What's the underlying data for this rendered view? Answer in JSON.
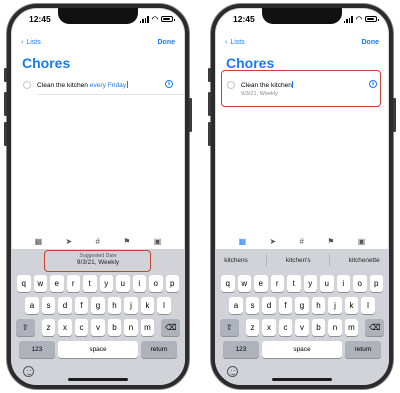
{
  "status": {
    "time": "12:45"
  },
  "nav": {
    "back_label": "Lists",
    "done_label": "Done"
  },
  "list_title": "Chores",
  "left": {
    "item_prefix": "Clean the kitchen ",
    "item_highlight": "every Friday",
    "suggestion_label": "Suggested Date",
    "suggestion_value": "9/3/21, Weekly"
  },
  "right": {
    "item_text": "Clean the kitchen",
    "item_sub": "9/3/21, Weekly",
    "suggestions": [
      "kitchens",
      "kitchen's",
      "kitchenette"
    ]
  },
  "keyboard": {
    "row1": [
      "q",
      "w",
      "e",
      "r",
      "t",
      "y",
      "u",
      "i",
      "o",
      "p"
    ],
    "row2": [
      "a",
      "s",
      "d",
      "f",
      "g",
      "h",
      "j",
      "k",
      "l"
    ],
    "row3": [
      "z",
      "x",
      "c",
      "v",
      "b",
      "n",
      "m"
    ],
    "numbers_label": "123",
    "space_label": "space",
    "return_label": "return"
  },
  "toolbar_icons": [
    "calendar-icon",
    "location-arrow-icon",
    "hashtag-icon",
    "flag-icon",
    "camera-icon"
  ],
  "colors": {
    "accent": "#1a7cf5",
    "highlight_box": "#c2452d",
    "keyboard_bg": "#d1d3d9"
  }
}
